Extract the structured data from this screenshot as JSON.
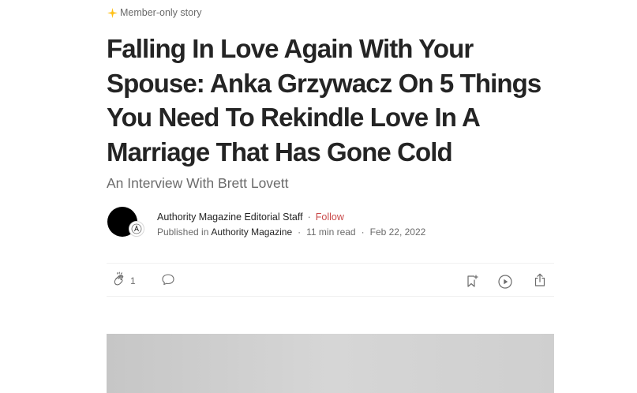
{
  "member_badge": {
    "label": "Member-only story",
    "icon": "sparkle-icon",
    "icon_color": "#ffc017"
  },
  "article": {
    "title": "Falling In Love Again With Your Spouse: Anka Grzywacz On 5 Things You Need To Rekindle Love In A Marriage That Has Gone Cold",
    "subtitle": "An Interview With Brett Lovett"
  },
  "author": {
    "name": "Authority Magazine Editorial Staff",
    "follow_label": "Follow",
    "follow_color": "#c94a4a",
    "published_in_label": "Published in",
    "publication": "Authority Magazine",
    "read_time": "11 min read",
    "date": "Feb 22, 2022",
    "separator": "·"
  },
  "actions": {
    "clap_count": "1",
    "icons": [
      "clap-icon",
      "comment-icon",
      "bookmark-icon",
      "play-icon",
      "share-icon"
    ]
  }
}
